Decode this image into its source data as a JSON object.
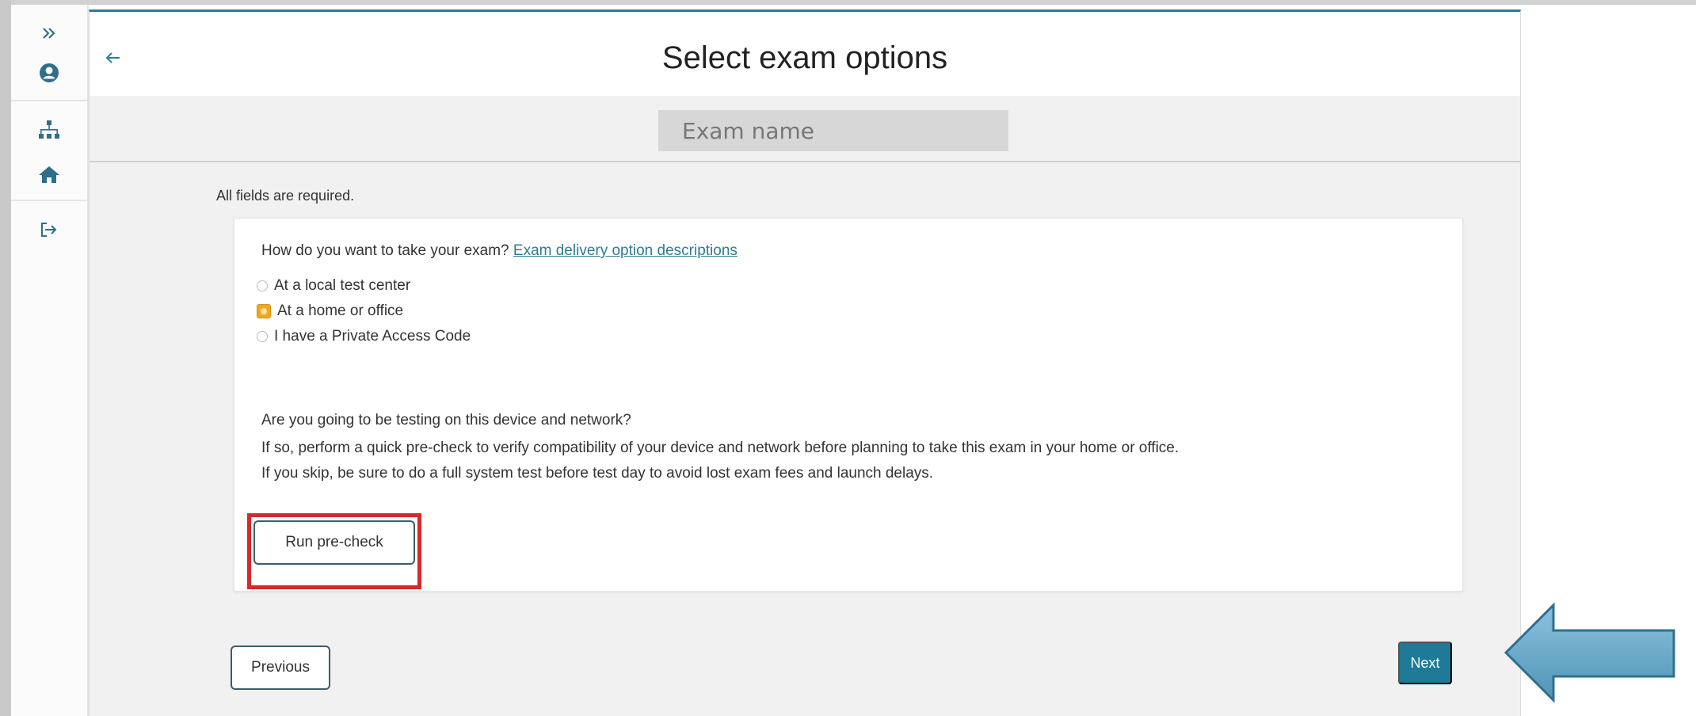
{
  "header": {
    "title": "Select exam options",
    "exam_name": "Exam name"
  },
  "sidebar": {
    "items": [
      {
        "icon": "double-chevron-right-icon"
      },
      {
        "icon": "user-icon"
      },
      {
        "icon": "sitemap-icon"
      },
      {
        "icon": "home-icon"
      },
      {
        "icon": "sign-out-icon"
      }
    ]
  },
  "form": {
    "required_note": "All fields are required.",
    "question1": "How do you want to take your exam?",
    "delivery_link": "Exam delivery option descriptions",
    "options": [
      {
        "label": "At a local test center",
        "selected": false
      },
      {
        "label": "At a home or office",
        "selected": true
      },
      {
        "label": "I have a Private Access Code",
        "selected": false
      }
    ],
    "question2": "Are you going to be testing on this device and network?",
    "info_line1": "If so, perform a quick pre-check to verify compatibility of your device and network before planning to take this exam in your home or office.",
    "info_line2": "If you skip, be sure to do a full system test before test day to avoid lost exam fees and launch delays.",
    "precheck_button": "Run pre-check"
  },
  "footer": {
    "previous_button": "Previous",
    "next_button": "Next"
  },
  "colors": {
    "accent": "#2f7c95",
    "next_bg": "#1e7a96",
    "selected_radio": "#f0a81f",
    "highlight_border": "#d8282a",
    "callout_arrow": "#66a8c9"
  }
}
